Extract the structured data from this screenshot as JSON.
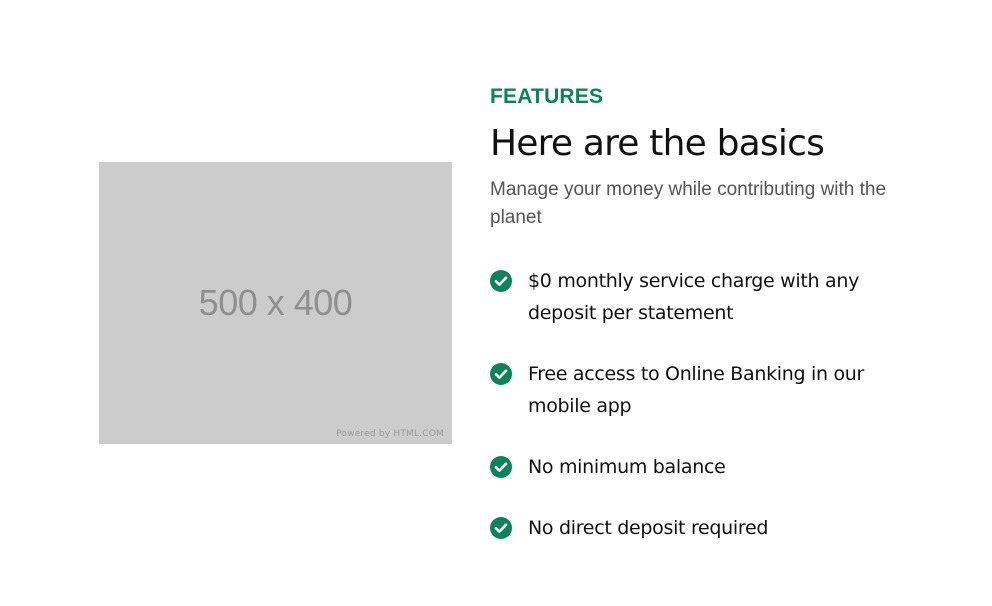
{
  "image_placeholder": {
    "dimensions_label": "500 x 400",
    "credit": "Powered by HTML.COM"
  },
  "section": {
    "eyebrow": "FEATURES",
    "title": "Here are the basics",
    "subtitle": "Manage your money while contributing with the planet"
  },
  "features": [
    {
      "text": "$0 monthly service charge with any deposit per statement",
      "icon": "check-circle-icon"
    },
    {
      "text": "Free access to Online Banking in our mobile app",
      "icon": "check-circle-icon"
    },
    {
      "text": "No minimum balance",
      "icon": "check-circle-icon"
    },
    {
      "text": "No direct deposit required",
      "icon": "check-circle-icon"
    }
  ],
  "colors": {
    "accent": "#0a8458",
    "placeholder_bg": "#cccccc",
    "heading": "#111111",
    "subtitle": "#555555"
  }
}
